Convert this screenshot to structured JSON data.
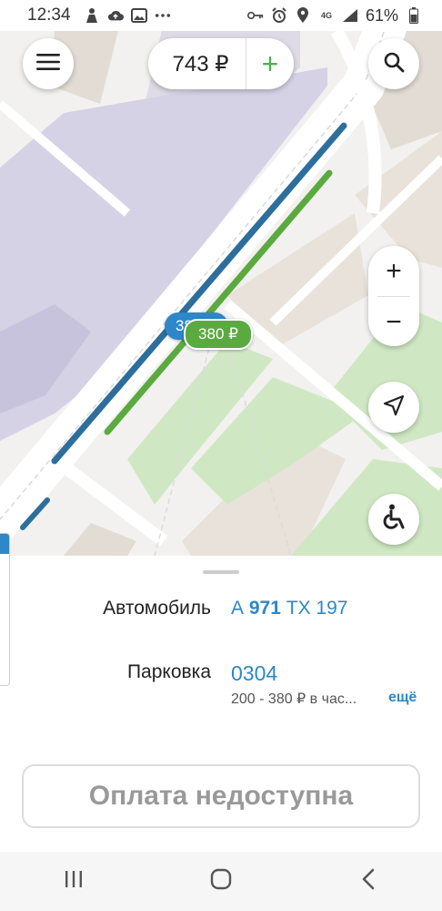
{
  "status_bar": {
    "time": "12:34",
    "signal_type": "4G",
    "battery": "61%"
  },
  "top": {
    "balance": "743 ₽",
    "add_label": "+"
  },
  "map": {
    "tag_blue": "380 ₽",
    "tag_green": "380 ₽",
    "zoom_in": "+",
    "zoom_out": "−"
  },
  "info": {
    "car_label": "Автомобиль",
    "car_prefix": "А",
    "car_number": "971",
    "car_suffix": "ТХ 197",
    "parking_label": "Парковка",
    "parking_code": "0304",
    "parking_price": "200 - 380 ₽ в час...",
    "more_link": "ещё"
  },
  "pay_button": "Оплата недоступна",
  "colors": {
    "accent_blue": "#2d87c8",
    "accent_green": "#5aaa3f"
  }
}
